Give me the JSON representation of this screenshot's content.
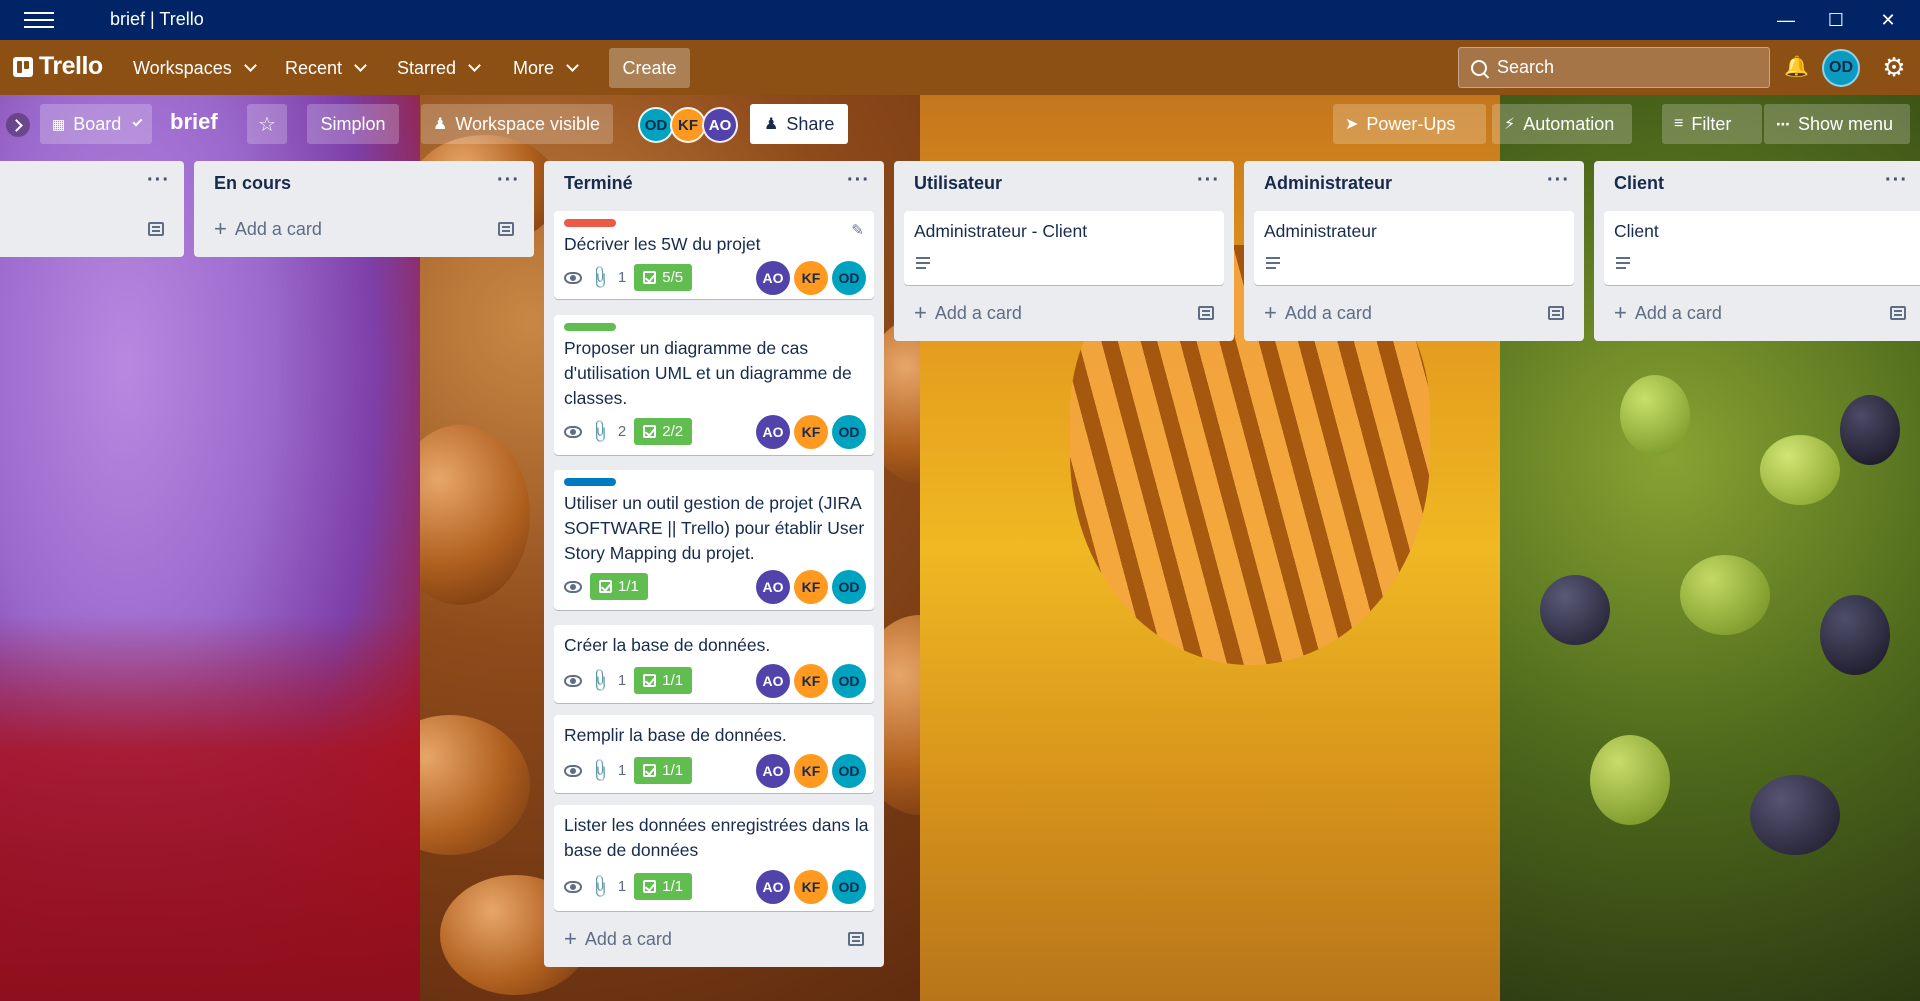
{
  "window": {
    "title": "brief | Trello"
  },
  "appbar": {
    "logo": "Trello",
    "nav": [
      "Workspaces",
      "Recent",
      "Starred",
      "More"
    ],
    "create": "Create",
    "search_placeholder": "Search",
    "avatar": "OD"
  },
  "board": {
    "view": "Board",
    "title": "brief",
    "workspace": "Simplon",
    "visibility": "Workspace visible",
    "members": [
      "OD",
      "KF",
      "AO"
    ],
    "share": "Share",
    "powerups": "Power-Ups",
    "automation": "Automation",
    "filter": "Filter",
    "show_menu": "Show menu"
  },
  "lists": {
    "encours": {
      "title": "En cours",
      "add": "Add a card"
    },
    "termine": {
      "title": "Terminé",
      "add": "Add a card",
      "cards": [
        {
          "label_color": "#eb5a46",
          "title": "Décriver les 5W du projet",
          "attachments": "1",
          "checklist": "5/5",
          "members": [
            "AO",
            "KF",
            "OD"
          ]
        },
        {
          "label_color": "#61bd4f",
          "title_lines": [
            "Proposer un diagramme de cas",
            "d'utilisation UML et un diagramme de",
            "classes."
          ],
          "attachments": "2",
          "checklist": "2/2",
          "members": [
            "AO",
            "KF",
            "OD"
          ]
        },
        {
          "label_color": "#0079bf",
          "title_lines": [
            "Utiliser un outil gestion de projet (JIRA",
            "SOFTWARE || Trello) pour établir User",
            "Story Mapping du projet."
          ],
          "checklist": "1/1",
          "members": [
            "AO",
            "KF",
            "OD"
          ]
        },
        {
          "title": "Créer la base de données.",
          "attachments": "1",
          "checklist": "1/1",
          "members": [
            "AO",
            "KF",
            "OD"
          ]
        },
        {
          "title": "Remplir la base de données.",
          "attachments": "1",
          "checklist": "1/1",
          "members": [
            "AO",
            "KF",
            "OD"
          ]
        },
        {
          "title_lines": [
            "Lister les données enregistrées dans la",
            "base de données"
          ],
          "attachments": "1",
          "checklist": "1/1",
          "members": [
            "AO",
            "KF",
            "OD"
          ]
        }
      ]
    },
    "utilisateur": {
      "title": "Utilisateur",
      "card": "Administrateur - Client",
      "add": "Add a card"
    },
    "administrateur": {
      "title": "Administrateur",
      "card": "Administrateur",
      "add": "Add a card"
    },
    "client": {
      "title": "Client",
      "card": "Client",
      "add": "Add a card"
    }
  },
  "colors": {
    "appbar": "#8c4f14",
    "titlebar": "#002466",
    "checklist_done": "#61bd4f"
  }
}
